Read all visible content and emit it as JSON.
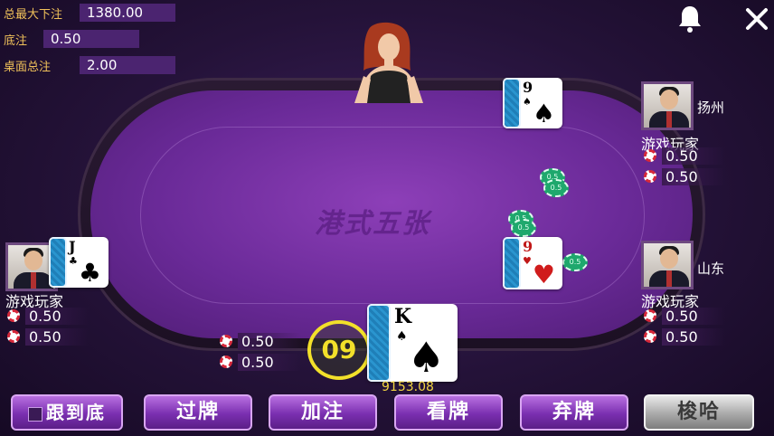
{
  "stats": {
    "max_total_bet_label": "总最大下注",
    "max_total_bet_value": "1380.00",
    "base_bet_label": "底注",
    "base_bet_value": "0.50",
    "table_total_label": "桌面总注",
    "table_total_value": "2.00"
  },
  "table_logo": "港式五张",
  "players": {
    "top_right": {
      "location": "扬州",
      "name": "游戏玩家",
      "bets": [
        "0.50",
        "0.50"
      ],
      "card": {
        "rank": "9",
        "suit": "♠"
      }
    },
    "mid_right": {
      "location": "山东",
      "name": "游戏玩家",
      "bets": [
        "0.50",
        "0.50"
      ],
      "card": {
        "rank": "9",
        "suit": "♥"
      }
    },
    "left": {
      "name": "游戏玩家",
      "bets": [
        "0.50",
        "0.50"
      ],
      "card": {
        "rank": "J",
        "suit": "♣"
      }
    },
    "self": {
      "bets": [
        "0.50",
        "0.50"
      ],
      "card": {
        "rank": "K",
        "suit": "♠"
      },
      "timer": "09",
      "coins": "9153.08"
    }
  },
  "table_chip_label": "0.5",
  "buttons": {
    "follow_all": "跟到底",
    "pass": "过牌",
    "raise": "加注",
    "look": "看牌",
    "fold": "弃牌",
    "showhand": "梭哈"
  },
  "icons": {
    "bell": "bell-icon",
    "close": "close-icon"
  },
  "colors": {
    "accent_purple": "#6a2a98",
    "gold": "#f0c15a",
    "chip_red": "#d6283a",
    "chip_green": "#1fa86d"
  }
}
